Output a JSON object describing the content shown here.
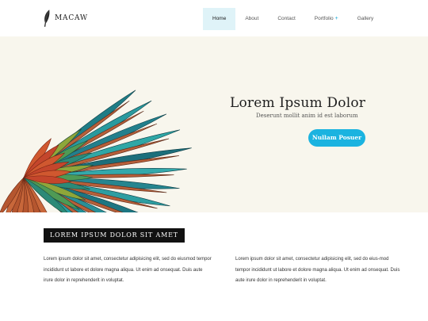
{
  "brand": {
    "name": "MACAW",
    "logo_icon": "feather-icon"
  },
  "nav": {
    "items": [
      {
        "label": "Home"
      },
      {
        "label": "About"
      },
      {
        "label": "Contact"
      },
      {
        "label": "Portfolio",
        "submenu_marker": "+"
      },
      {
        "label": "Gallery"
      }
    ]
  },
  "hero": {
    "title": "Lorem Ipsum Dolor",
    "subtitle": "Deserunt mollit anim id est laborum",
    "button_label": "Nullam Posuer",
    "image": "macaw-wing",
    "accent_color": "#1bb3e0"
  },
  "section": {
    "heading": "LOREM IPSUM DOLOR SIT AMET",
    "col1": "Lorem ipsum dolor sit amet, consectetur adipisicing elit, sed do eiusmod tempor incididunt ut labore et dolore magna aliqua. Ut enim ad onsequat. Duis aute irure dolor in reprehenderit in voluptat.",
    "col2": "Lorem ipsum dolor sit amet, consectetur adipisicing elit, sed do eius-mod tempor incididunt ut labore et dolore magna aliqua. Ut enim ad onsequat. Duis aute irure dolor in reprehenderit in voluptat."
  }
}
